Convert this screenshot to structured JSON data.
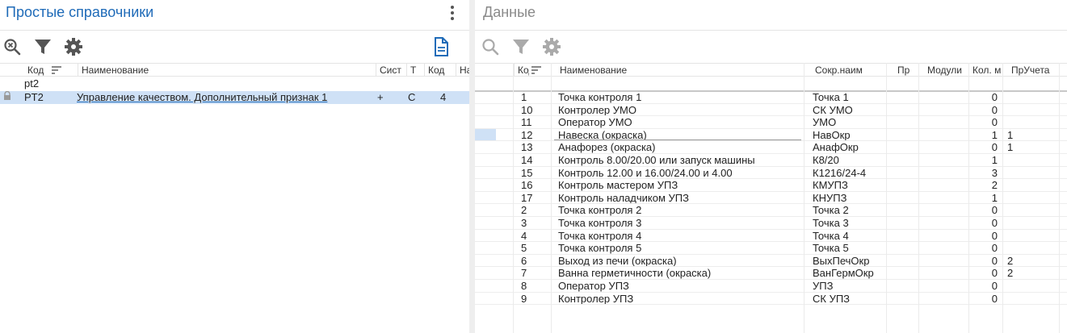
{
  "left": {
    "title": "Простые справочники",
    "columns": [
      "Код",
      "Наименование",
      "Сист",
      "Т",
      "Код",
      "На"
    ],
    "filter_value": "pt2",
    "row": {
      "code": "PT2",
      "name": "Управление качеством. Дополнительный признак 1",
      "sist": "+",
      "t": "С",
      "kod": "4"
    },
    "icons": {
      "search": "search-clear-icon",
      "filter": "filter-icon",
      "settings": "gear-icon",
      "doc": "document-icon",
      "lock": "lock-icon",
      "sort": "sort-icon",
      "menu": "kebab-menu-icon"
    },
    "accent_color": "#1f6bb8"
  },
  "right": {
    "title": "Данные",
    "columns": [
      "Код",
      "Наименование",
      "Сокр.наим",
      "Пр",
      "Модули",
      "Кол. м",
      "ПрУчета"
    ],
    "rows": [
      {
        "code": "1",
        "name": "Точка контроля 1",
        "short": "Точка 1",
        "kol": "0",
        "pruch": ""
      },
      {
        "code": "10",
        "name": "Контролер УМО",
        "short": "СК УМО",
        "kol": "0",
        "pruch": ""
      },
      {
        "code": "11",
        "name": "Оператор УМО",
        "short": "УМО",
        "kol": "0",
        "pruch": ""
      },
      {
        "code": "12",
        "name": "Навеска (окраска)",
        "short": "НавОкр",
        "kol": "1",
        "pruch": "1"
      },
      {
        "code": "13",
        "name": "Анафорез (окраска)",
        "short": "АнафОкр",
        "kol": "0",
        "pruch": "1"
      },
      {
        "code": "14",
        "name": "Контроль 8.00/20.00 или запуск машины",
        "short": "К8/20",
        "kol": "1",
        "pruch": ""
      },
      {
        "code": "15",
        "name": "Контроль 12.00 и 16.00/24.00 и 4.00",
        "short": "К1216/24-4",
        "kol": "3",
        "pruch": ""
      },
      {
        "code": "16",
        "name": "Контроль мастером УПЗ",
        "short": "КМУПЗ",
        "kol": "2",
        "pruch": ""
      },
      {
        "code": "17",
        "name": "Контроль наладчиком УПЗ",
        "short": "КНУПЗ",
        "kol": "1",
        "pruch": ""
      },
      {
        "code": "2",
        "name": "Точка контроля 2",
        "short": "Точка 2",
        "kol": "0",
        "pruch": ""
      },
      {
        "code": "3",
        "name": "Точка контроля 3",
        "short": "Точка 3",
        "kol": "0",
        "pruch": ""
      },
      {
        "code": "4",
        "name": "Точка контроля 4",
        "short": "Точка 4",
        "kol": "0",
        "pruch": ""
      },
      {
        "code": "5",
        "name": "Точка контроля 5",
        "short": "Точка 5",
        "kol": "0",
        "pruch": ""
      },
      {
        "code": "6",
        "name": "Выход из печи (окраска)",
        "short": "ВыхПечОкр",
        "kol": "0",
        "pruch": "2"
      },
      {
        "code": "7",
        "name": "Ванна герметичности (окраска)",
        "short": "ВанГермОкр",
        "kol": "0",
        "pruch": "2"
      },
      {
        "code": "8",
        "name": "Оператор УПЗ",
        "short": "УПЗ",
        "kol": "0",
        "pruch": ""
      },
      {
        "code": "9",
        "name": "Контролер УПЗ",
        "short": "СК УПЗ",
        "kol": "0",
        "pruch": ""
      }
    ],
    "icons": {
      "search": "search-icon",
      "filter": "filter-icon",
      "settings": "gear-icon"
    }
  }
}
